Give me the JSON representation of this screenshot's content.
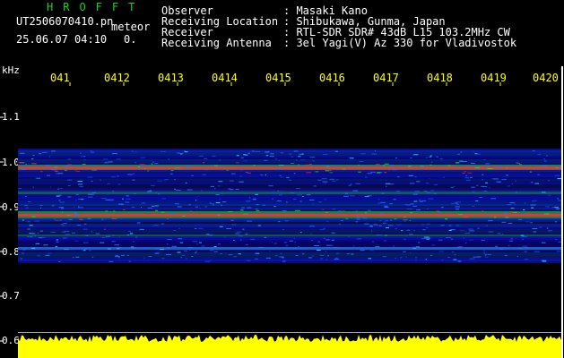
{
  "header": {
    "app_title": "HROFFT",
    "filename": "UT2506070410.pn",
    "meteor_label": "meteor",
    "datetime": "25.06.07 04:10",
    "count": "0.",
    "fields": [
      {
        "label": "Observer",
        "value": ": Masaki Kano"
      },
      {
        "label": "Receiving Location",
        "value": ": Shibukawa, Gunma, Japan"
      },
      {
        "label": "Receiver",
        "value": ": RTL-SDR SDR# 43dB L15 103.2MHz CW"
      },
      {
        "label": "Receiving Antenna",
        "value": ": 3el Yagi(V) Az 330 for Vladivostok"
      }
    ]
  },
  "axis": {
    "unit": "kHz",
    "y_labels": [
      "1.1",
      "1.0",
      "0.9",
      "0.8",
      "0.7",
      "0.6"
    ],
    "time_labels": [
      "041",
      "0412",
      "0413",
      "0414",
      "0415",
      "0416",
      "0417",
      "0418",
      "0419",
      "0420"
    ]
  },
  "colors": {
    "title_green": "#18d418",
    "time_yellow": "#ffff00",
    "band_blue": "#0a1aa8",
    "line_red": "#ff2a3a",
    "line_green": "#2ad83a",
    "noise_yellow": "#ffff00"
  }
}
